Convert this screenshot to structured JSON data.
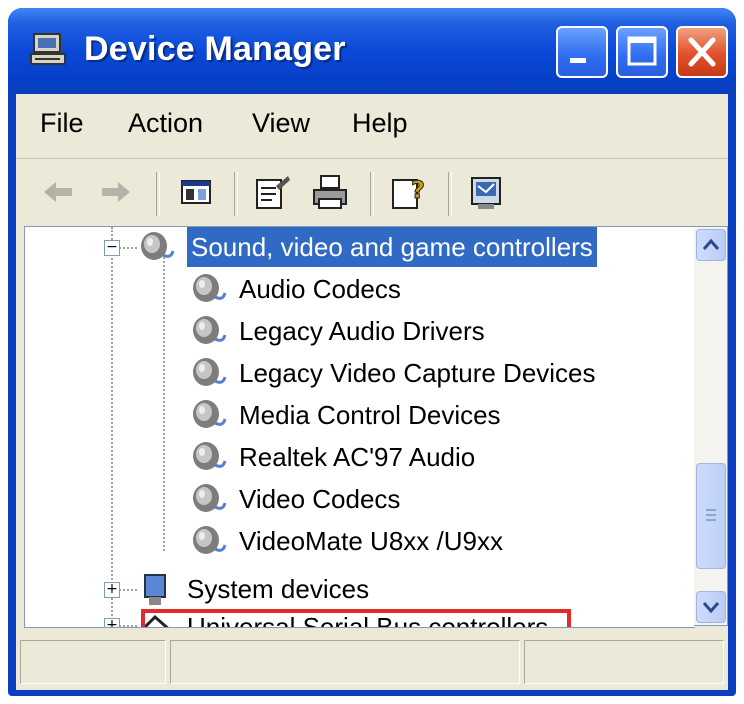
{
  "window": {
    "title": "Device Manager"
  },
  "menu": {
    "items": [
      "File",
      "Action",
      "View",
      "Help"
    ]
  },
  "tree": {
    "category": "Sound, video and game controllers",
    "children": [
      "Audio Codecs",
      "Legacy Audio Drivers",
      "Legacy Video Capture Devices",
      "Media Control Devices",
      "Realtek AC'97 Audio",
      "Video Codecs",
      "VideoMate U8xx /U9xx"
    ],
    "after": [
      "System devices",
      "Universal Serial Bus controllers"
    ]
  },
  "colors": {
    "title_blue": "#0a49d8",
    "selection": "#316ac5",
    "highlight_box": "#e32b2b"
  }
}
